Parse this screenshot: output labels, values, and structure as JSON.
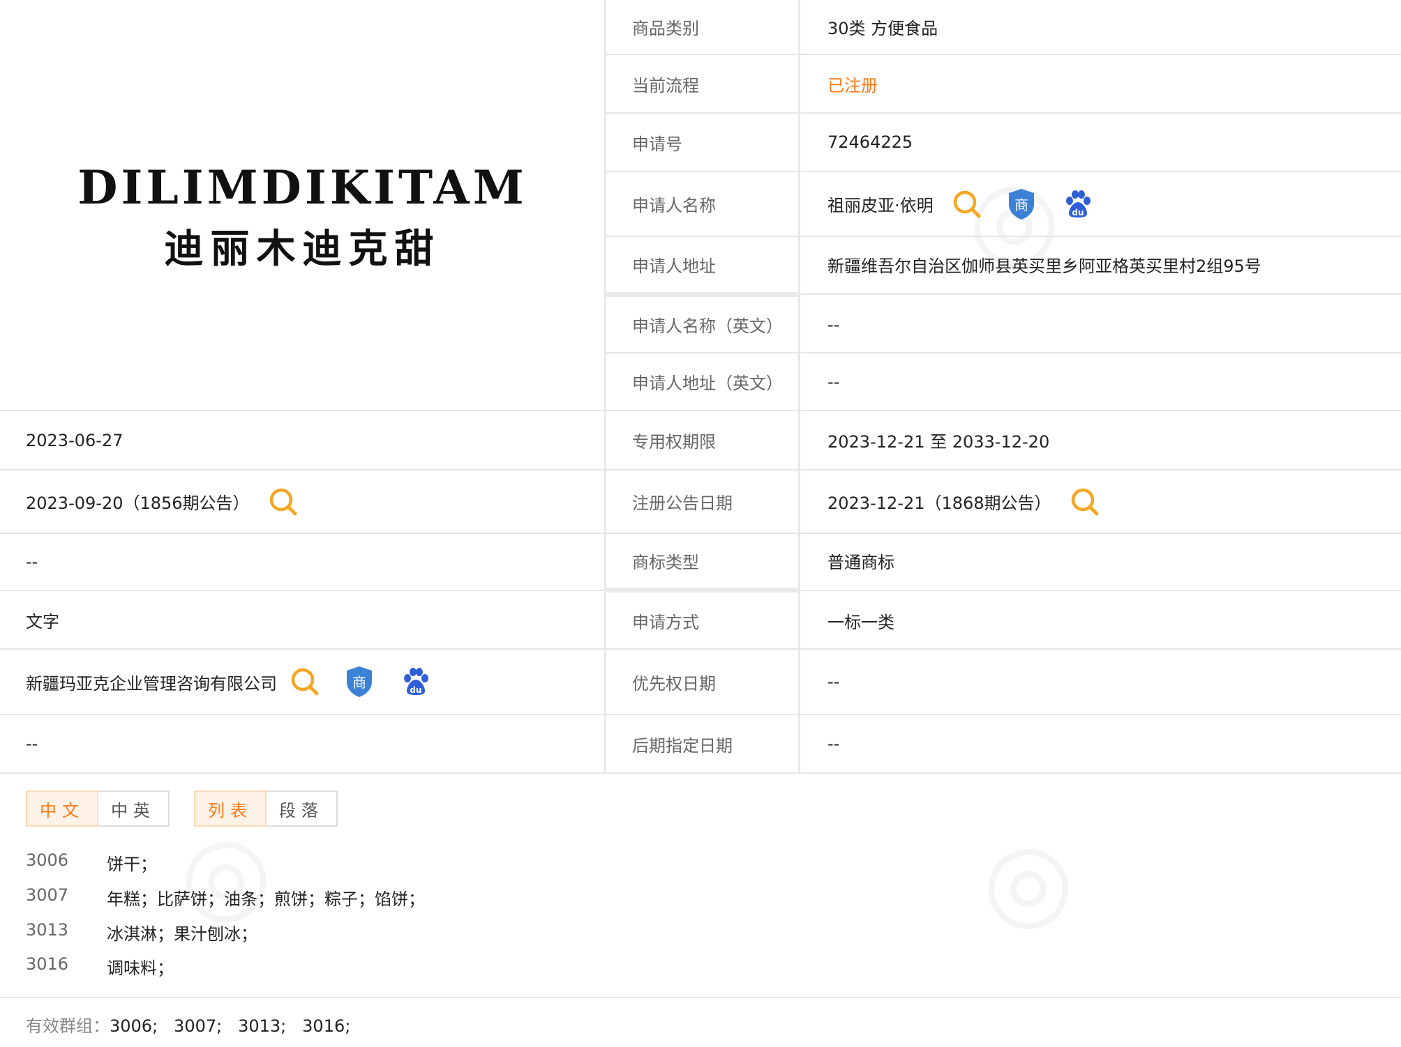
{
  "logo": {
    "en": "DILIMDIKITAM",
    "zh": "迪丽木迪克甜"
  },
  "right_rows": [
    {
      "label": "商品类别",
      "value": "30类 方便食品"
    },
    {
      "label": "当前流程",
      "value": "已注册"
    },
    {
      "label": "申请号",
      "value": "72464225"
    },
    {
      "label": "申请人名称",
      "value": "祖丽皮亚·依明"
    },
    {
      "label": "申请人地址",
      "value": "新疆维吾尔自治区伽师县英买里乡阿亚格英买里村2组95号"
    },
    {
      "label": "申请人名称（英文）",
      "value": "--"
    },
    {
      "label": "申请人地址（英文）",
      "value": "--"
    },
    {
      "label": "专用权期限",
      "value": "2023-12-21 至 2033-12-20"
    },
    {
      "label": "注册公告日期",
      "value": "2023-12-21（1868期公告）"
    },
    {
      "label": "商标类型",
      "value": "普通商标"
    },
    {
      "label": "申请方式",
      "value": "一标一类"
    },
    {
      "label": "优先权日期",
      "value": "--"
    },
    {
      "label": "后期指定日期",
      "value": "--"
    }
  ],
  "left_rows": [
    {
      "value": "2023-06-27"
    },
    {
      "value": "2023-09-20（1856期公告）"
    },
    {
      "value": "--"
    },
    {
      "value": "文字"
    },
    {
      "value": "新疆玛亚克企业管理咨询有限公司"
    },
    {
      "value": "--"
    }
  ],
  "lang_buttons": [
    "中文",
    "中英"
  ],
  "view_buttons": [
    "列表",
    "段落"
  ],
  "goods": [
    {
      "code": "3006",
      "name": "饼干；"
    },
    {
      "code": "3007",
      "name": "年糕；比萨饼；油条；煎饼；粽子；馅饼；"
    },
    {
      "code": "3013",
      "name": "冰淇淋；果汁刨冰；"
    },
    {
      "code": "3016",
      "name": "调味料；"
    }
  ],
  "footer": {
    "label": "有效群组：",
    "value": "3006;   3007;   3013;   3016;"
  },
  "icons": {
    "search": "search-icon",
    "shang": "shang-shield-icon",
    "baidu": "baidu-paw-icon",
    "shang_char": "商"
  },
  "colors": {
    "accent": "#ff7a1a",
    "search": "#f5a623",
    "shield": "#3b82d6",
    "baidu": "#2f5fd8"
  }
}
